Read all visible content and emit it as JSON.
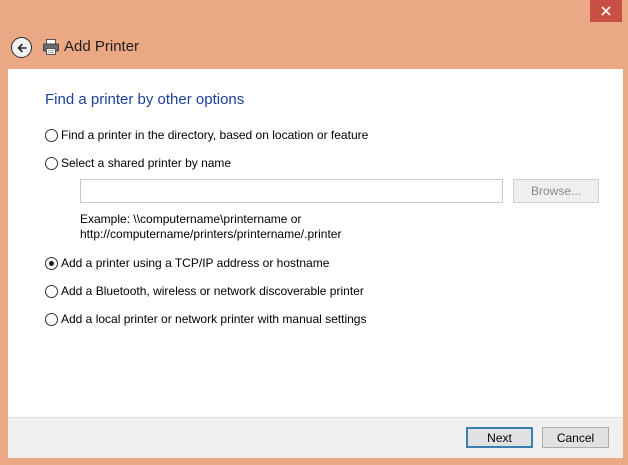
{
  "window": {
    "title": "Add Printer",
    "close_icon": "close-icon",
    "accent_color": "#e9a882",
    "close_color": "#c74f43"
  },
  "header": {
    "back_icon": "back-arrow-icon",
    "printer_icon": "printer-icon",
    "title": "Add Printer"
  },
  "page": {
    "heading": "Find a printer by other options",
    "options": [
      {
        "label": "Find a printer in the directory, based on location or feature",
        "checked": false
      },
      {
        "label": "Select a shared printer by name",
        "checked": false
      },
      {
        "label": "Add a printer using a TCP/IP address or hostname",
        "checked": true
      },
      {
        "label": "Add a Bluetooth, wireless or network discoverable printer",
        "checked": false
      },
      {
        "label": "Add a local printer or network printer with manual settings",
        "checked": false
      }
    ],
    "shared_name_input": {
      "value": "",
      "placeholder": ""
    },
    "browse_label": "Browse...",
    "example_line1": "Example: \\\\computername\\printername or",
    "example_line2": "http://computername/printers/printername/.printer"
  },
  "footer": {
    "next_label": "Next",
    "cancel_label": "Cancel"
  }
}
